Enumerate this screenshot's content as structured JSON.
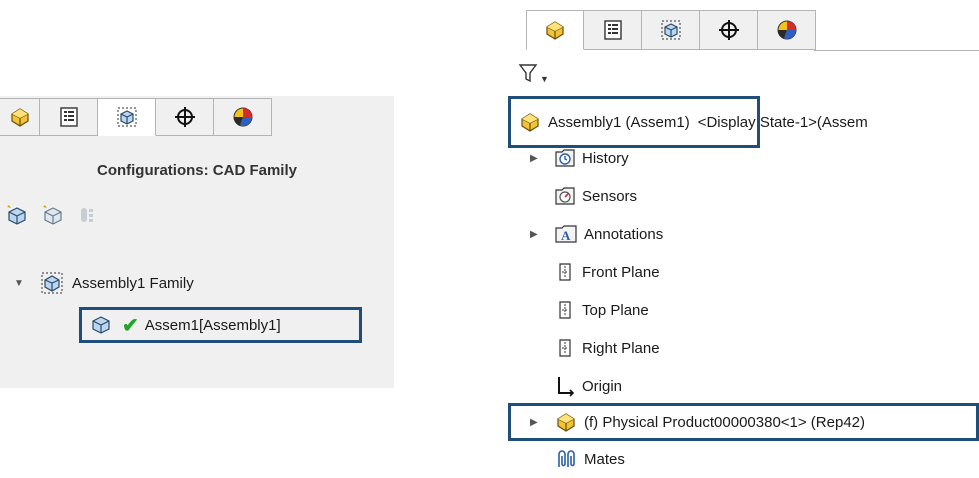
{
  "left": {
    "tabs": [
      {
        "icon": "feature-manager-icon",
        "active": false
      },
      {
        "icon": "property-manager-icon",
        "active": false
      },
      {
        "icon": "configuration-manager-icon",
        "active": true
      },
      {
        "icon": "dimxpert-manager-icon",
        "active": false
      },
      {
        "icon": "display-manager-icon",
        "active": false
      }
    ],
    "title": "Configurations: CAD Family",
    "tools": [
      "add-configuration-icon",
      "add-derived-configuration-icon",
      "toggle-display-icon"
    ],
    "tree": {
      "family_label": "Assembly1 Family",
      "config_label": "Assem1[Assembly1]"
    }
  },
  "right": {
    "tabs": [
      {
        "icon": "feature-manager-icon",
        "active": true
      },
      {
        "icon": "property-manager-icon",
        "active": false
      },
      {
        "icon": "configuration-manager-icon",
        "active": false
      },
      {
        "icon": "dimxpert-manager-icon",
        "active": false
      },
      {
        "icon": "display-manager-icon",
        "active": false
      }
    ],
    "root_label": "Assembly1 (Assem1)",
    "root_suffix": "<Display State-1>(Assem",
    "items": [
      {
        "label": "History",
        "icon": "history-icon",
        "expandable": true
      },
      {
        "label": "Sensors",
        "icon": "sensors-icon",
        "expandable": false
      },
      {
        "label": "Annotations",
        "icon": "annotations-icon",
        "expandable": true
      },
      {
        "label": "Front Plane",
        "icon": "plane-icon",
        "expandable": false
      },
      {
        "label": "Top Plane",
        "icon": "plane-icon",
        "expandable": false
      },
      {
        "label": "Right Plane",
        "icon": "plane-icon",
        "expandable": false
      },
      {
        "label": "Origin",
        "icon": "origin-icon",
        "expandable": false
      },
      {
        "label": "(f) Physical Product00000380<1> (Rep42)",
        "icon": "assembly-icon",
        "expandable": true
      },
      {
        "label": "Mates",
        "icon": "mates-icon",
        "expandable": false
      }
    ]
  },
  "colors": {
    "highlight_border": "#1f4e79",
    "check": "#22a32a",
    "panel_bg": "#f0f0f0"
  }
}
